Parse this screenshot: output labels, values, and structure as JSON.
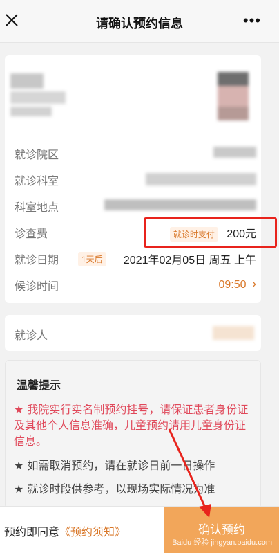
{
  "nav": {
    "title": "请确认预约信息",
    "more": "•••"
  },
  "info": {
    "campus_label": "就诊院区",
    "dept_label": "就诊科室",
    "location_label": "科室地点",
    "fee_label": "诊查费",
    "fee_badge": "就诊时支付",
    "fee_value": "200元",
    "date_label": "就诊日期",
    "date_badge": "1天后",
    "date_value": "2021年02月05日 周五 上午",
    "wait_label": "候诊时间",
    "wait_value": "09:50",
    "wait_chevron": "›"
  },
  "patient": {
    "label": "就诊人"
  },
  "tips": {
    "title": "温馨提示",
    "items": [
      "我院实行实名制预约挂号，请保证患者身份证及其他个人信息准确，儿童预约请用儿童身份证信息。",
      "如需取消预约，请在就诊日前一日操作",
      "就诊时段供参考，以现场实际情况为准"
    ],
    "star": "★"
  },
  "footer": {
    "agree_text": "预约即同意",
    "agree_link": "《预约须知》",
    "confirm_label": "确认预约",
    "watermark": "Baidu 经验 jingyan.baidu.com"
  },
  "colors": {
    "accent": "#f2a65a",
    "link": "#d9782a",
    "highlight": "#e8231c",
    "tip_red": "#e0485a"
  }
}
